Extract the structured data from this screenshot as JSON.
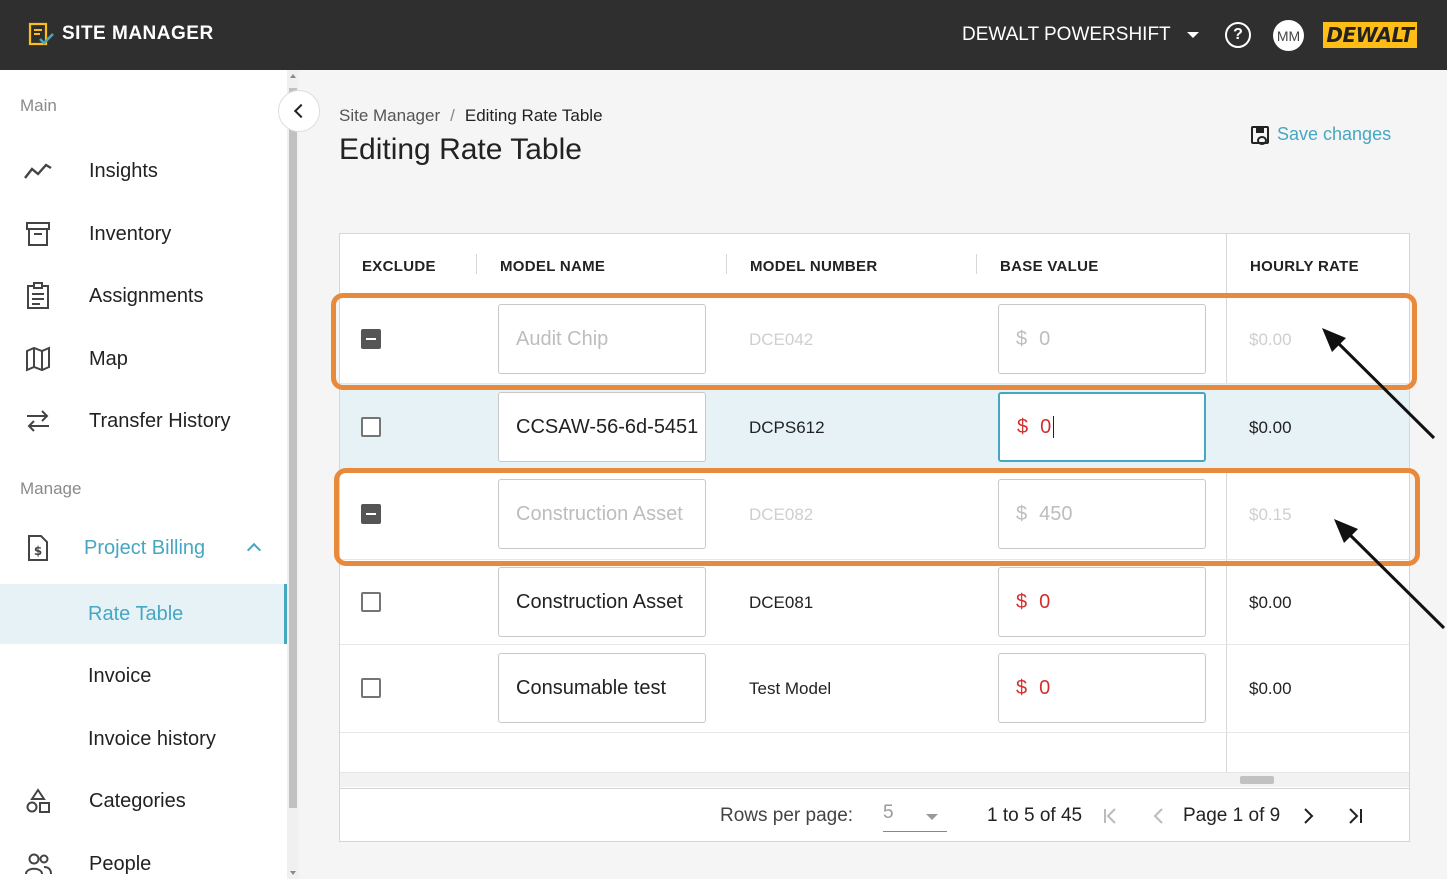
{
  "app": {
    "title": "SITE MANAGER",
    "tenant": "DEWALT POWERSHIFT",
    "help_label": "?",
    "avatar_initials": "MM",
    "brand_logo": "DEWALT"
  },
  "sidebar": {
    "sections": [
      {
        "label": "Main"
      },
      {
        "label": "Manage"
      }
    ],
    "main_items": [
      {
        "label": "Insights",
        "icon": "trending-up-icon"
      },
      {
        "label": "Inventory",
        "icon": "archive-box-icon"
      },
      {
        "label": "Assignments",
        "icon": "clipboard-icon"
      },
      {
        "label": "Map",
        "icon": "map-icon"
      },
      {
        "label": "Transfer History",
        "icon": "transfer-arrows-icon"
      }
    ],
    "billing_group": {
      "label": "Project Billing",
      "icon": "billing-document-icon"
    },
    "billing_items": [
      {
        "label": "Rate Table",
        "active": true
      },
      {
        "label": "Invoice"
      },
      {
        "label": "Invoice history"
      }
    ],
    "more_items": [
      {
        "label": "Categories",
        "icon": "shapes-icon"
      },
      {
        "label": "People",
        "icon": "people-icon"
      }
    ]
  },
  "breadcrumb": {
    "root": "Site Manager",
    "sep": "/",
    "current": "Editing Rate Table"
  },
  "page_title": "Editing Rate Table",
  "save_label": "Save changes",
  "table": {
    "columns": [
      "EXCLUDE",
      "MODEL NAME",
      "MODEL NUMBER",
      "BASE VALUE",
      "HOURLY RATE"
    ],
    "rows": [
      {
        "excluded": true,
        "model_name": "Audit Chip",
        "model_number": "DCE042",
        "currency": "$",
        "base_value": "0",
        "hourly_rate": "$0.00"
      },
      {
        "excluded": false,
        "model_name": "CCSAW-56-6d-5451",
        "model_number": "DCPS612",
        "currency": "$",
        "base_value": "0",
        "hourly_rate": "$0.00",
        "focused": true
      },
      {
        "excluded": true,
        "model_name": "Construction Asset",
        "model_number": "DCE082",
        "currency": "$",
        "base_value": "450",
        "hourly_rate": "$0.15"
      },
      {
        "excluded": false,
        "model_name": "Construction Asset",
        "model_number": "DCE081",
        "currency": "$",
        "base_value": "0",
        "hourly_rate": "$0.00"
      },
      {
        "excluded": false,
        "model_name": "Consumable test",
        "model_number": "Test Model",
        "currency": "$",
        "base_value": "0",
        "hourly_rate": "$0.00"
      }
    ]
  },
  "pagination": {
    "rows_per_page_label": "Rows per page:",
    "rows_per_page_value": "5",
    "range": "1 to 5 of 45",
    "page_info": "Page 1 of 9"
  },
  "colors": {
    "accent": "#46a7c2",
    "topbar": "#2f2f2f",
    "annotation": "#e8893b",
    "error_red": "#d32f2f",
    "brand_yellow": "#febd17"
  }
}
